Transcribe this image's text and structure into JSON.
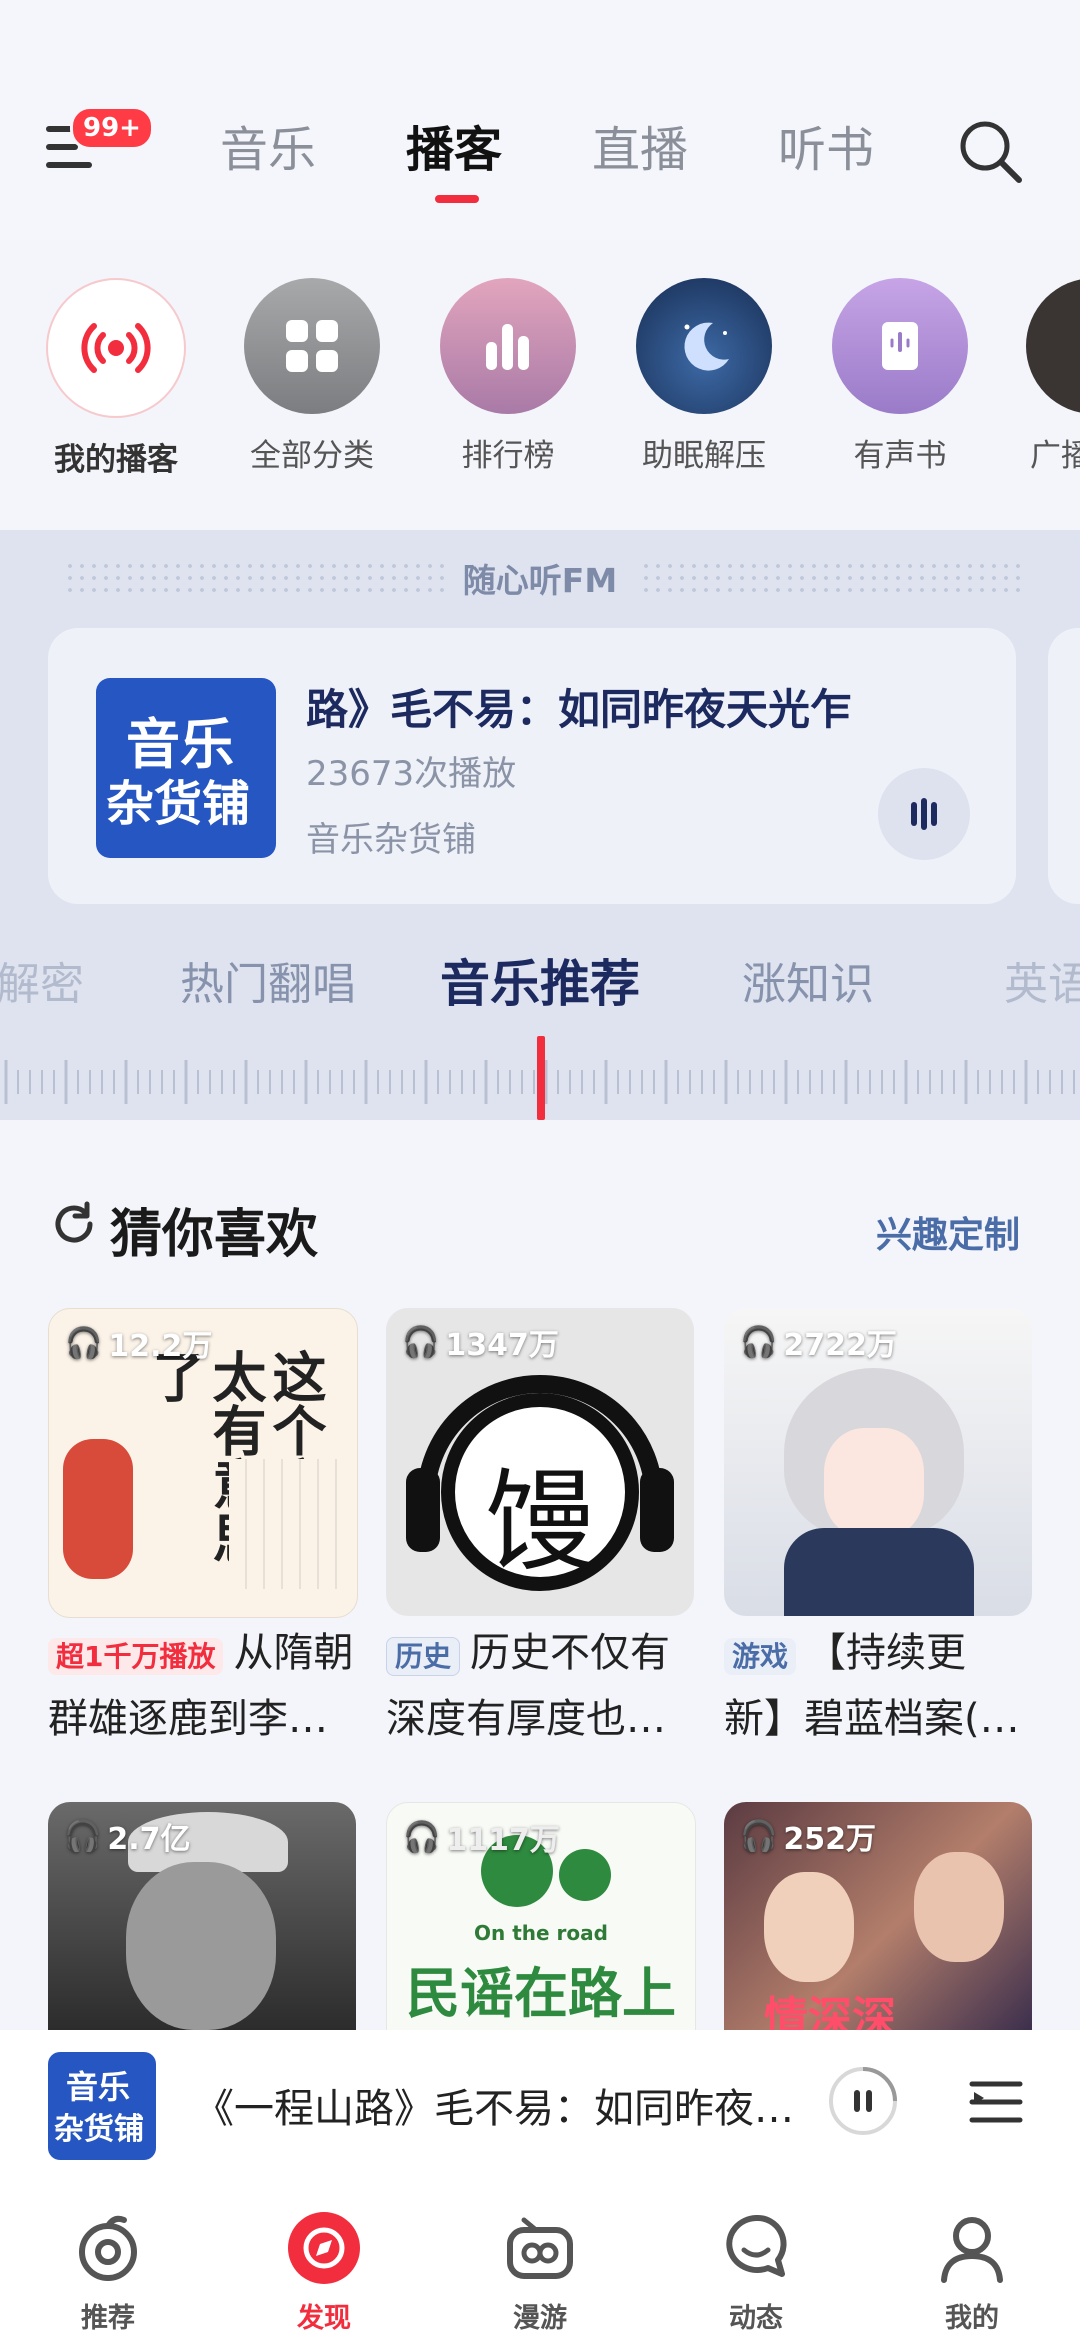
{
  "header": {
    "badge": "99+",
    "tabs": [
      "音乐",
      "播客",
      "直播",
      "听书"
    ],
    "active_tab": "播客"
  },
  "categories": [
    {
      "label": "我的播客",
      "icon": "broadcast-icon"
    },
    {
      "label": "全部分类",
      "icon": "grid-icon"
    },
    {
      "label": "排行榜",
      "icon": "bar-chart-icon"
    },
    {
      "label": "助眠解压",
      "icon": "moon-icon"
    },
    {
      "label": "有声书",
      "icon": "book-icon"
    },
    {
      "label": "广播",
      "icon": "radio-icon"
    }
  ],
  "fm": {
    "title": "随心听FM",
    "song": "路》毛不易：如同昨夜天光乍",
    "plays": "23673次播放",
    "author": "音乐杂货铺",
    "cover_text_1": "音乐",
    "cover_text_2": "杂货铺",
    "tabs": [
      "解密",
      "热门翻唱",
      "音乐推荐",
      "涨知识",
      "英语"
    ],
    "active_tab": "音乐推荐"
  },
  "guess": {
    "title": "猜你喜欢",
    "link": "兴趣定制",
    "items": [
      {
        "count": "12.2万",
        "tag": "超1千万播放",
        "title_1": "从隋朝",
        "title_2": "群雄逐鹿到李…",
        "cover": "这个唐朝太有意思了"
      },
      {
        "count": "1347万",
        "tag": "历史",
        "title_1": "历史不仅有",
        "title_2": "深度有厚度也…",
        "cover": "馒"
      },
      {
        "count": "2722万",
        "tag": "游戏",
        "title_1": "【持续更",
        "title_2": "新】碧蓝档案(…",
        "cover": ""
      },
      {
        "count": "2.7亿",
        "cover": ""
      },
      {
        "count": "1117万",
        "cover": "民谣在路上",
        "cover_sub": "On the road"
      },
      {
        "count": "252万",
        "cover": "情深深"
      }
    ]
  },
  "mini_player": {
    "title": "《一程山路》毛不易：如同昨夜…",
    "cover_text_1": "音乐",
    "cover_text_2": "杂货铺"
  },
  "bottom_nav": [
    {
      "label": "推荐",
      "icon": "netease-icon"
    },
    {
      "label": "发现",
      "icon": "compass-icon"
    },
    {
      "label": "漫游",
      "icon": "radio-roam-icon"
    },
    {
      "label": "动态",
      "icon": "chat-icon"
    },
    {
      "label": "我的",
      "icon": "user-icon"
    }
  ],
  "colors": {
    "accent": "#f22d3e",
    "fm_title": "#1d2a60",
    "link": "#4a6da8"
  }
}
